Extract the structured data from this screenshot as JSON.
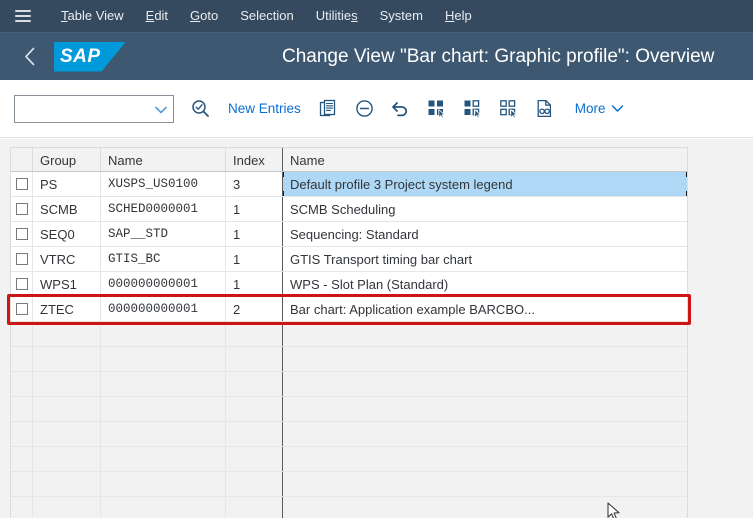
{
  "menu": {
    "hamburger_icon": "hamburger-menu-icon",
    "items": [
      {
        "label": "Table View",
        "mnemonic": "T"
      },
      {
        "label": "Edit",
        "mnemonic": "E"
      },
      {
        "label": "Goto",
        "mnemonic": "G"
      },
      {
        "label": "Selection",
        "mnemonic": "S"
      },
      {
        "label": "Utilities",
        "mnemonic": "s"
      },
      {
        "label": "System",
        "mnemonic": "y"
      },
      {
        "label": "Help",
        "mnemonic": "H"
      }
    ]
  },
  "titlebar": {
    "back_icon": "back-chevron-icon",
    "logo_text": "SAP",
    "title": "Change View \"Bar chart: Graphic profile\": Overview"
  },
  "toolbar": {
    "combo_value": "",
    "combo_placeholder": "",
    "combo_chevron_icon": "chevron-down-icon",
    "search_icon": "search-check-icon",
    "new_entries_label": "New Entries",
    "copy_icon": "copy-entry-icon",
    "delete_icon": "minus-circle-icon",
    "undo_icon": "undo-arrow-icon",
    "select_all_icon": "select-all-icon",
    "select_some_icon": "select-block-icon",
    "deselect_all_icon": "deselect-all-icon",
    "details_icon": "document-glasses-icon",
    "more_label": "More",
    "more_chevron_icon": "chevron-down-icon"
  },
  "table": {
    "columns": [
      "",
      "Group",
      "Name",
      "Index",
      "Name"
    ],
    "rows": [
      {
        "checked": false,
        "group": "PS",
        "name": "XUSPS_US0100",
        "index": "3",
        "description": "Default profile 3 Project system legend",
        "selected": true
      },
      {
        "checked": false,
        "group": "SCMB",
        "name": "SCHED0000001",
        "index": "1",
        "description": "SCMB Scheduling",
        "selected": false
      },
      {
        "checked": false,
        "group": "SEQ0",
        "name": "SAP__STD",
        "index": "1",
        "description": "Sequencing: Standard",
        "selected": false
      },
      {
        "checked": false,
        "group": "VTRC",
        "name": "GTIS_BC",
        "index": "1",
        "description": "GTIS Transport timing bar chart",
        "selected": false
      },
      {
        "checked": false,
        "group": "WPS1",
        "name": "000000000001",
        "index": "1",
        "description": "WPS - Slot Plan (Standard)",
        "selected": false
      },
      {
        "checked": false,
        "group": "ZTEC",
        "name": "000000000001",
        "index": "2",
        "description": "Bar chart: Application example BARCBO...",
        "selected": false
      }
    ],
    "empty_row_count": 8
  },
  "annotation": {
    "highlight_color": "#cc1616",
    "target_row_index": 5
  },
  "colors": {
    "menubar_bg": "#354a5f",
    "titlebar_bg": "#3e5871",
    "sap_blue": "#009ada",
    "link_blue": "#0a6ed1",
    "row_selected": "#aed8f5",
    "table_bg": "#f2f2f2"
  }
}
